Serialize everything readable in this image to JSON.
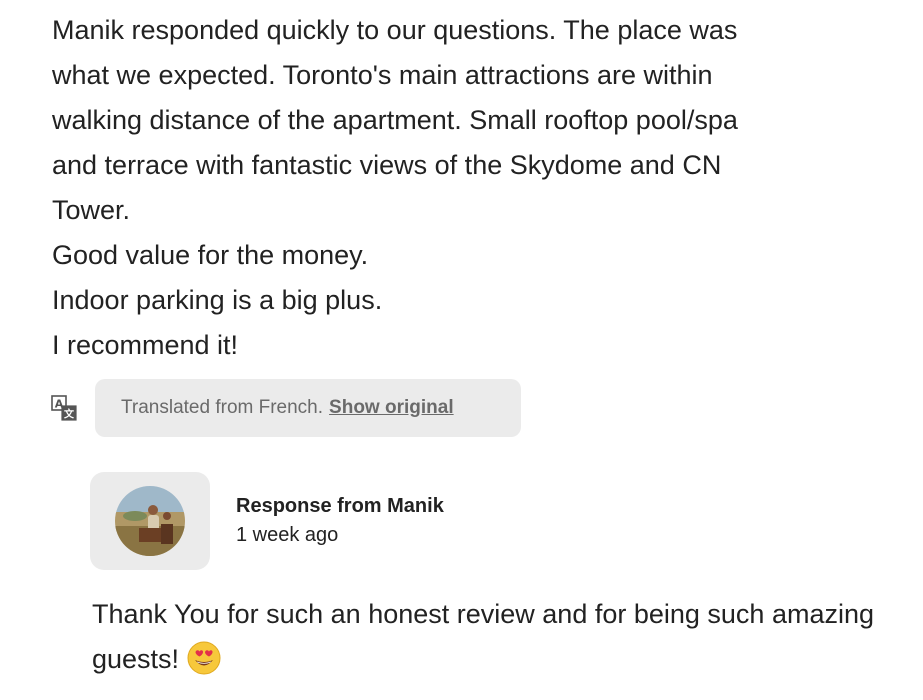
{
  "review": {
    "lines": [
      "Manik responded quickly to our questions. The place was",
      "what we expected. Toronto's main attractions are within",
      "walking distance of the apartment. Small rooftop pool/spa",
      "and terrace with fantastic views of the Skydome and CN",
      "Tower.",
      "Good value for the money.",
      "Indoor parking is a big plus.",
      "I recommend it!"
    ]
  },
  "translation": {
    "icon": "translate-icon",
    "note": "Translated from French.",
    "link": "Show original"
  },
  "response": {
    "title": "Response from Manik",
    "time": "1 week ago",
    "text": "Thank You for such an honest review and for being such amazing guests!",
    "emoji": "smiling-face-with-heart-eyes"
  }
}
